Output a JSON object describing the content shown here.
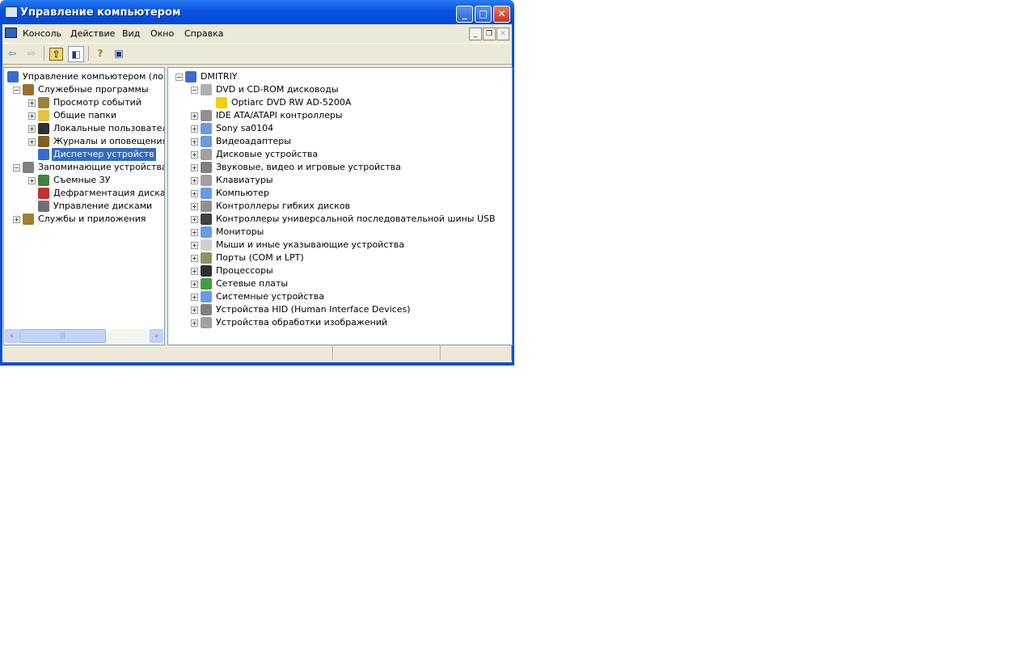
{
  "window": {
    "title": "Управление компьютером"
  },
  "menu": [
    "Консоль",
    "Действие",
    "Вид",
    "Окно",
    "Справка"
  ],
  "toolbar": {
    "back": "⇦",
    "forward": "⇨",
    "up": "⇧",
    "showhide": "◧",
    "help": "?",
    "props": "▣"
  },
  "left_tree": [
    {
      "level": 0,
      "label": "Управление компьютером (локальный)",
      "exp": "",
      "icon": "computer-icon",
      "color": "#3a6ad0"
    },
    {
      "level": 1,
      "label": "Служебные программы",
      "exp": "−",
      "icon": "tools-icon",
      "color": "#9a7030"
    },
    {
      "level": 2,
      "label": "Просмотр событий",
      "exp": "+",
      "icon": "event-viewer-icon",
      "color": "#a08040"
    },
    {
      "level": 2,
      "label": "Общие папки",
      "exp": "+",
      "icon": "shared-folder-icon",
      "color": "#e8c040"
    },
    {
      "level": 2,
      "label": "Локальные пользователи",
      "exp": "+",
      "icon": "users-icon",
      "color": "#303030"
    },
    {
      "level": 2,
      "label": "Журналы и оповещения производительности",
      "exp": "+",
      "icon": "performance-icon",
      "color": "#806020"
    },
    {
      "level": 2,
      "label": "Диспетчер устройств",
      "exp": "",
      "icon": "device-manager-icon",
      "color": "#3a6ad0",
      "selected": true
    },
    {
      "level": 1,
      "label": "Запоминающие устройства",
      "exp": "−",
      "icon": "storage-icon",
      "color": "#808080"
    },
    {
      "level": 2,
      "label": "Съемные ЗУ",
      "exp": "+",
      "icon": "removable-storage-icon",
      "color": "#408040"
    },
    {
      "level": 2,
      "label": "Дефрагментация диска",
      "exp": "",
      "icon": "defrag-icon",
      "color": "#c03030"
    },
    {
      "level": 2,
      "label": "Управление дисками",
      "exp": "",
      "icon": "disk-management-icon",
      "color": "#707070"
    },
    {
      "level": 1,
      "label": "Службы и приложения",
      "exp": "+",
      "icon": "services-icon",
      "color": "#a08030"
    }
  ],
  "right_tree": [
    {
      "level": 0,
      "label": "DMITRIY",
      "exp": "−",
      "icon": "computer-icon",
      "color": "#3a6ad0"
    },
    {
      "level": 1,
      "label": "DVD и CD-ROM дисководы",
      "exp": "−",
      "icon": "cdrom-icon",
      "color": "#b0b0b0"
    },
    {
      "level": 2,
      "label": "Optiarc DVD RW AD-5200A",
      "exp": "",
      "icon": "warning-icon",
      "color": "#f0d000"
    },
    {
      "level": 1,
      "label": "IDE ATA/ATAPI контроллеры",
      "exp": "+",
      "icon": "ide-controller-icon",
      "color": "#909090"
    },
    {
      "level": 1,
      "label": "Sony sa0104",
      "exp": "+",
      "icon": "device-icon",
      "color": "#6a9ae0"
    },
    {
      "level": 1,
      "label": "Видеоадаптеры",
      "exp": "+",
      "icon": "display-adapter-icon",
      "color": "#6a9ae0"
    },
    {
      "level": 1,
      "label": "Дисковые устройства",
      "exp": "+",
      "icon": "disk-drive-icon",
      "color": "#a0a0a0"
    },
    {
      "level": 1,
      "label": "Звуковые, видео и игровые устройства",
      "exp": "+",
      "icon": "sound-icon",
      "color": "#808080"
    },
    {
      "level": 1,
      "label": "Клавиатуры",
      "exp": "+",
      "icon": "keyboard-icon",
      "color": "#a0a0a0"
    },
    {
      "level": 1,
      "label": "Компьютер",
      "exp": "+",
      "icon": "computer-icon",
      "color": "#6a9ae0"
    },
    {
      "level": 1,
      "label": "Контроллеры гибких дисков",
      "exp": "+",
      "icon": "floppy-controller-icon",
      "color": "#909090"
    },
    {
      "level": 1,
      "label": "Контроллеры универсальной последовательной шины USB",
      "exp": "+",
      "icon": "usb-icon",
      "color": "#404040"
    },
    {
      "level": 1,
      "label": "Мониторы",
      "exp": "+",
      "icon": "monitor-icon",
      "color": "#6a9ae0"
    },
    {
      "level": 1,
      "label": "Мыши и иные указывающие устройства",
      "exp": "+",
      "icon": "mouse-icon",
      "color": "#d0d0d0"
    },
    {
      "level": 1,
      "label": "Порты (COM и LPT)",
      "exp": "+",
      "icon": "port-icon",
      "color": "#909060"
    },
    {
      "level": 1,
      "label": "Процессоры",
      "exp": "+",
      "icon": "processor-icon",
      "color": "#303030"
    },
    {
      "level": 1,
      "label": "Сетевые платы",
      "exp": "+",
      "icon": "network-card-icon",
      "color": "#40a040"
    },
    {
      "level": 1,
      "label": "Системные устройства",
      "exp": "+",
      "icon": "system-device-icon",
      "color": "#6a9ae0"
    },
    {
      "level": 1,
      "label": "Устройства HID (Human Interface Devices)",
      "exp": "+",
      "icon": "hid-icon",
      "color": "#808080"
    },
    {
      "level": 1,
      "label": "Устройства обработки изображений",
      "exp": "+",
      "icon": "imaging-icon",
      "color": "#a0a0a0"
    }
  ],
  "scroll": {
    "thumb": "|||"
  }
}
